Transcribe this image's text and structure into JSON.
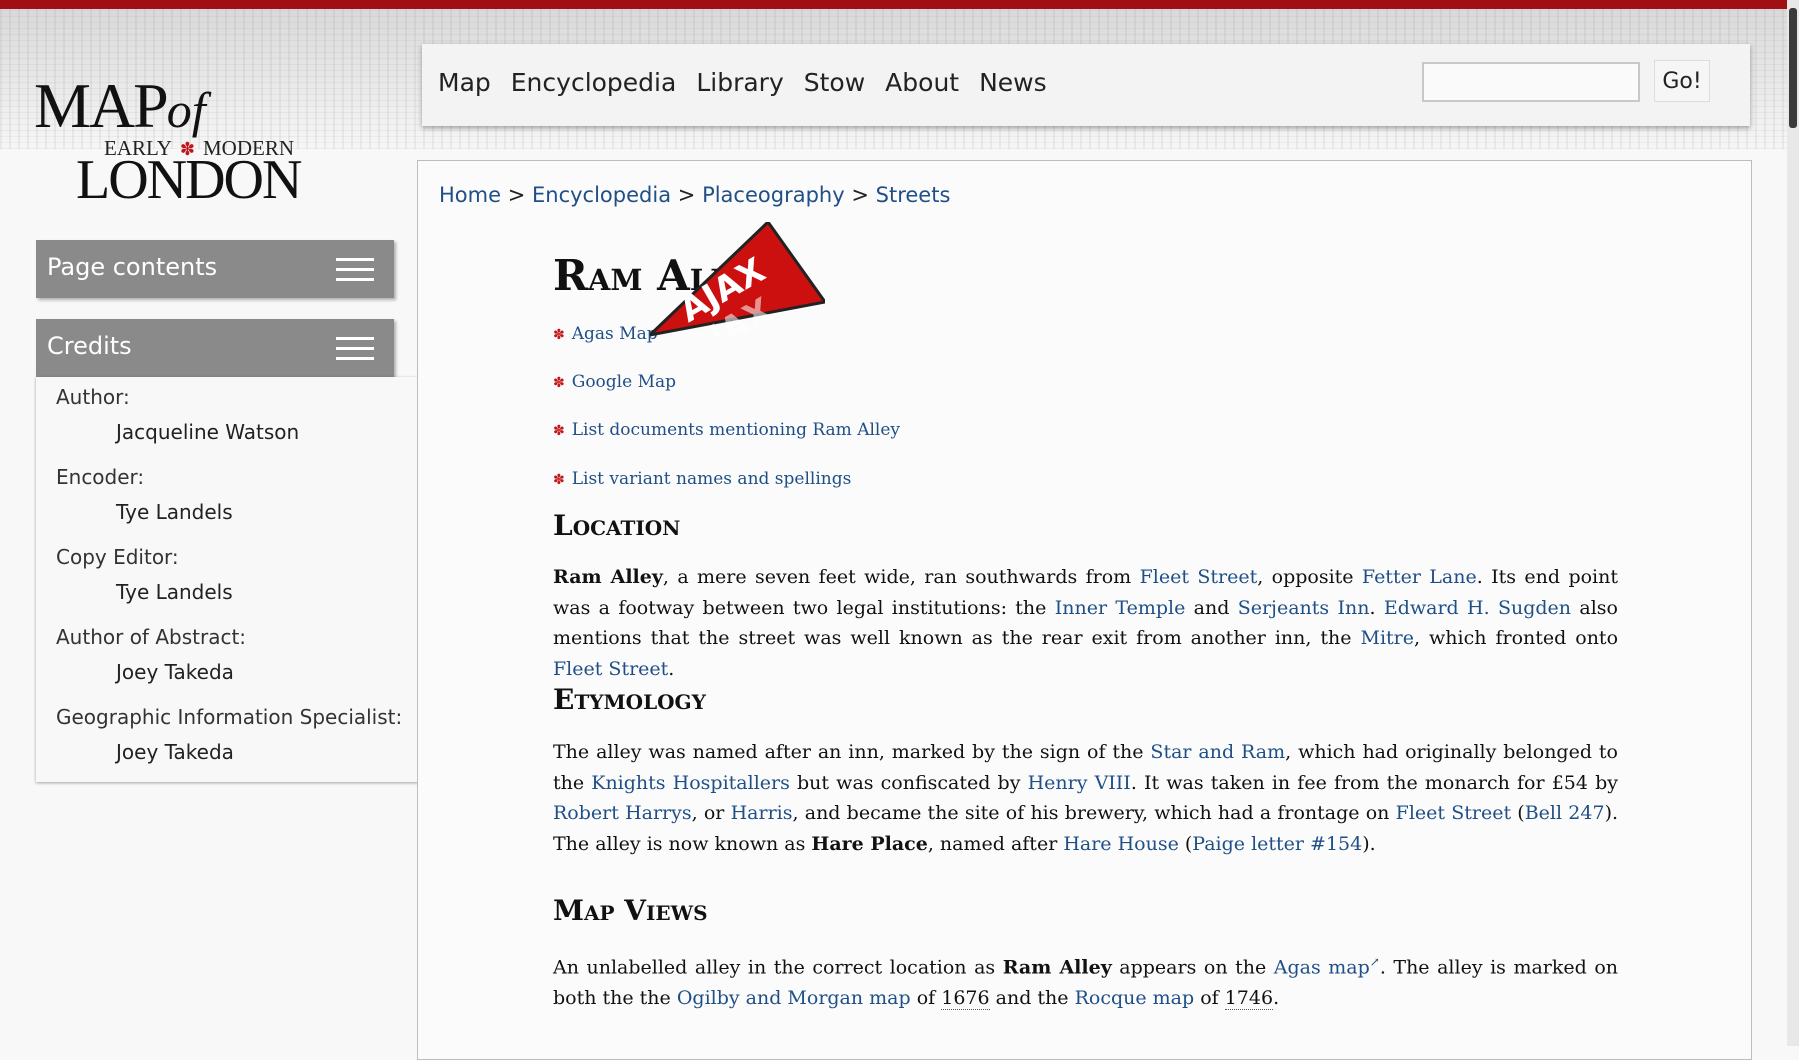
{
  "logo": {
    "line1": "MAP",
    "of": "of",
    "line2a": "EARLY",
    "rose": "✽",
    "line2b": "MODERN",
    "line3": "LONDON"
  },
  "nav": {
    "items": [
      {
        "label": "Map"
      },
      {
        "label": "Encyclopedia"
      },
      {
        "label": "Library"
      },
      {
        "label": "Stow"
      },
      {
        "label": "About"
      },
      {
        "label": "News"
      }
    ],
    "search_value": "",
    "search_placeholder": "",
    "go_label": "Go!"
  },
  "sidebar": {
    "page_contents_label": "Page contents",
    "credits_label": "Credits",
    "credits": [
      {
        "role": "Author:",
        "name": "Jacqueline Watson"
      },
      {
        "role": "Encoder:",
        "name": "Tye Landels"
      },
      {
        "role": "Copy Editor:",
        "name": "Tye Landels"
      },
      {
        "role": "Author of Abstract:",
        "name": "Joey Takeda"
      },
      {
        "role": "Geographic Information Specialist:",
        "name": "Joey Takeda"
      }
    ]
  },
  "breadcrumb": {
    "home": "Home",
    "sep": ">",
    "encyclopedia": "Encyclopedia",
    "placeography": "Placeography",
    "streets": "Streets"
  },
  "article": {
    "title": "Ram Alley",
    "links": [
      "Agas Map",
      "Google Map",
      "List documents mentioning Ram Alley",
      "List variant names and spellings"
    ],
    "sections": {
      "location": "Location",
      "etymology": "Etymology",
      "map_views": "Map Views"
    }
  },
  "ajax_badge": {
    "text": "AJAX",
    "color": "#cc1010"
  }
}
